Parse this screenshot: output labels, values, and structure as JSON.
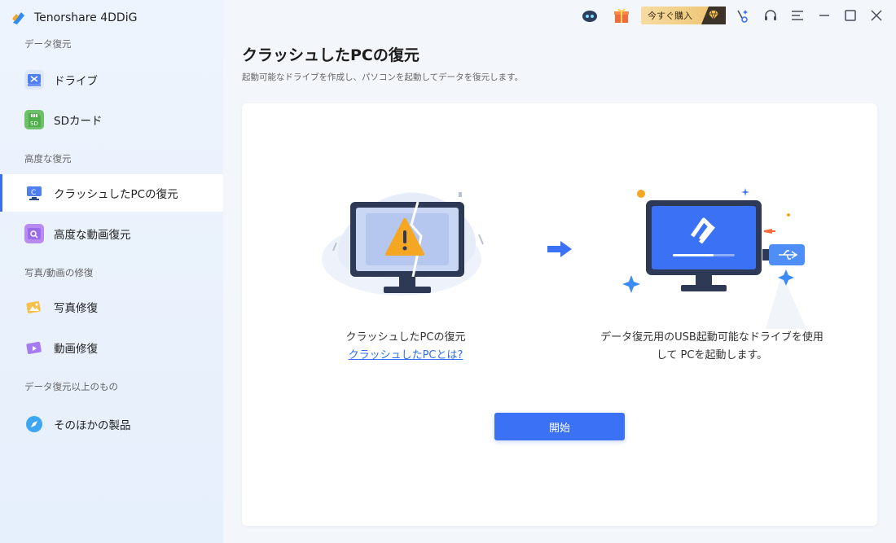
{
  "app": {
    "name": "Tenorshare 4DDiG"
  },
  "sidebar": {
    "sections": [
      {
        "label": "データ復元"
      },
      {
        "label": "高度な復元"
      },
      {
        "label": "写真/動画の修復"
      },
      {
        "label": "データ復元以上のもの"
      }
    ],
    "items": [
      {
        "label": "ドライブ",
        "icon": "drive-icon"
      },
      {
        "label": "SDカード",
        "icon": "sd-card-icon"
      },
      {
        "label": "クラッシュしたPCの復元",
        "icon": "crashed-pc-icon",
        "active": true
      },
      {
        "label": "高度な動画復元",
        "icon": "video-recovery-icon"
      },
      {
        "label": "写真修復",
        "icon": "photo-repair-icon"
      },
      {
        "label": "動画修復",
        "icon": "video-repair-icon"
      },
      {
        "label": "そのほかの製品",
        "icon": "compass-icon"
      }
    ]
  },
  "titlebar": {
    "buy_label": "今すぐ購入"
  },
  "main": {
    "title": "クラッシュしたPCの復元",
    "subtitle": "起動可能なドライブを作成し、パソコンを起動してデータを復元します。",
    "left_caption": "クラッシュしたPCの復元",
    "left_link": "クラッシュしたPCとは?",
    "right_caption": "データ復元用のUSB起動可能なドライブを使用して PCを起動します。",
    "start_label": "開始"
  },
  "colors": {
    "accent": "#3b72f5",
    "sidebar_bg": "#eaf1fc",
    "warning": "#f5a623"
  }
}
